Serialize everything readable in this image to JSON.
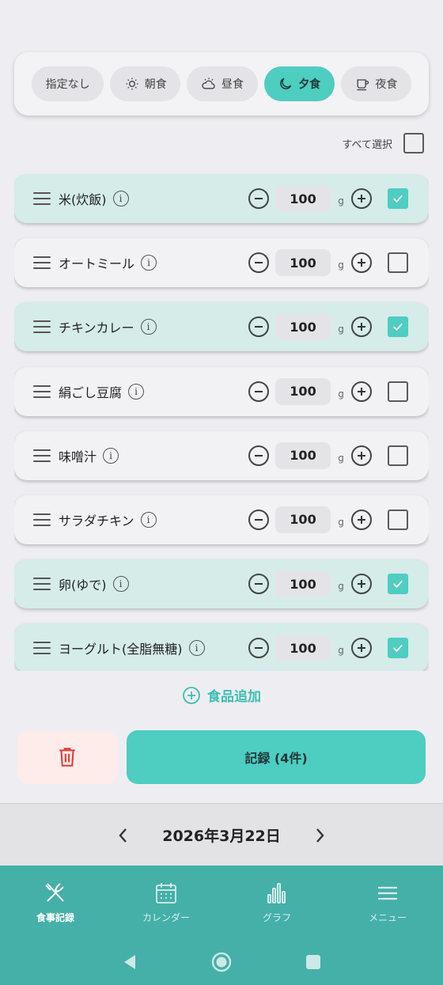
{
  "meal_tabs": [
    {
      "label": "指定なし",
      "icon": "none",
      "active": false
    },
    {
      "label": "朝食",
      "icon": "sun-icon",
      "active": false
    },
    {
      "label": "昼食",
      "icon": "cloud-sun-icon",
      "active": false
    },
    {
      "label": "夕食",
      "icon": "moon-icon",
      "active": true
    },
    {
      "label": "夜食",
      "icon": "cup-icon",
      "active": false
    }
  ],
  "select_all_label": "すべて選択",
  "unit": "g",
  "foods": [
    {
      "name": "米(炊飯)",
      "qty": "100",
      "checked": true
    },
    {
      "name": "オートミール",
      "qty": "100",
      "checked": false
    },
    {
      "name": "チキンカレー",
      "qty": "100",
      "checked": true
    },
    {
      "name": "絹ごし豆腐",
      "qty": "100",
      "checked": false
    },
    {
      "name": "味噌汁",
      "qty": "100",
      "checked": false
    },
    {
      "name": "サラダチキン",
      "qty": "100",
      "checked": false
    },
    {
      "name": "卵(ゆで)",
      "qty": "100",
      "checked": true
    },
    {
      "name": "ヨーグルト(全脂無糖)",
      "qty": "100",
      "checked": true
    }
  ],
  "add_food_label": "食品追加",
  "record_label": "記録 (4件)",
  "date": "2026年3月22日",
  "bottom_tabs": [
    {
      "label": "食事記録",
      "icon": "fork-knife-icon",
      "active": true
    },
    {
      "label": "カレンダー",
      "icon": "calendar-icon",
      "active": false
    },
    {
      "label": "グラフ",
      "icon": "bar-chart-icon",
      "active": false
    },
    {
      "label": "メニュー",
      "icon": "menu-icon",
      "active": false
    }
  ],
  "colors": {
    "accent": "#4ecdc1",
    "tabbar": "#45b0a8",
    "selected_row": "#d5ece9",
    "delete": "#e53935"
  }
}
